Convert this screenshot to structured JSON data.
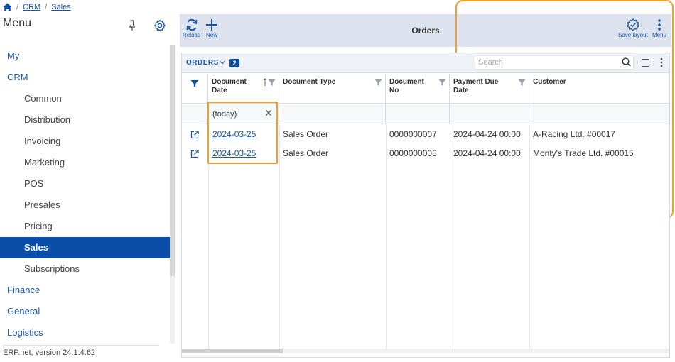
{
  "breadcrumb": {
    "items": [
      "CRM",
      "Sales"
    ]
  },
  "sidebar": {
    "title": "Menu",
    "items": [
      {
        "label": "My",
        "level": 0
      },
      {
        "label": "CRM",
        "level": 0
      },
      {
        "label": "Common",
        "level": 1
      },
      {
        "label": "Distribution",
        "level": 1
      },
      {
        "label": "Invoicing",
        "level": 1
      },
      {
        "label": "Marketing",
        "level": 1
      },
      {
        "label": "POS",
        "level": 1
      },
      {
        "label": "Presales",
        "level": 1
      },
      {
        "label": "Pricing",
        "level": 1
      },
      {
        "label": "Sales",
        "level": 1,
        "active": true
      },
      {
        "label": "Subscriptions",
        "level": 1
      },
      {
        "label": "Finance",
        "level": 0
      },
      {
        "label": "General",
        "level": 0
      },
      {
        "label": "Logistics",
        "level": 0
      }
    ],
    "footer": "ERP.net, version 24.1.4.62"
  },
  "toolbar": {
    "reload_label": "Reload",
    "new_label": "New",
    "title": "Orders",
    "save_layout_label": "Save layout",
    "menu_label": "Menu"
  },
  "grid": {
    "label": "ORDERS",
    "count": "2",
    "search_placeholder": "Search",
    "columns": [
      {
        "label": "Document Date"
      },
      {
        "label": "Document Type"
      },
      {
        "label": "Document No"
      },
      {
        "label": "Payment Due Date"
      },
      {
        "label": "Customer"
      }
    ],
    "filter_value": "(today)",
    "rows": [
      {
        "date": "2024-03-25",
        "type": "Sales Order",
        "no": "0000000007",
        "due": "2024-04-24 00:00",
        "customer": "A-Racing Ltd. #00017"
      },
      {
        "date": "2024-03-25",
        "type": "Sales Order",
        "no": "0000000008",
        "due": "2024-04-24 00:00",
        "customer": "Monty's Trade Ltd. #00015"
      }
    ]
  },
  "colors": {
    "accent": "#0a4da8",
    "highlight": "#f0a02c",
    "toolbar_bg": "#dde3ee"
  }
}
